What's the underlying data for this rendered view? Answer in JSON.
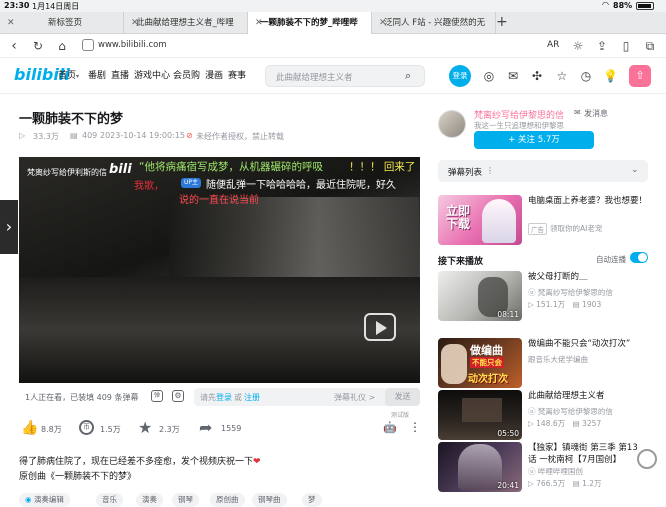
{
  "status": {
    "time": "23:30",
    "date": "1月14日周日",
    "battery": "88%"
  },
  "tabs": [
    {
      "label": "新标签页"
    },
    {
      "label": "此曲献给理想主义者_哔哩"
    },
    {
      "label": "一颗肺装不下的梦_哔哩哔"
    },
    {
      "label": "泛同人 F站 - 兴趣使然的无"
    }
  ],
  "address": {
    "url": "www.bilibili.com",
    "reader": "AR"
  },
  "header": {
    "logo": "bilibili",
    "nav": [
      "首页",
      "番剧",
      "直播",
      "游戏中心",
      "会员购",
      "漫画",
      "赛事"
    ],
    "search_placeholder": "此曲献给理想主义者",
    "login": "登录"
  },
  "video": {
    "title": "一颗肺装不下的梦",
    "plays": "33.3万",
    "danmaku": "409",
    "datetime": "2023-10-14 19:00:15",
    "reprint_notice": "未经作者授权，禁止转载",
    "watermark_user": "梵离纱写给伊利斯的信",
    "overlay_1": "“他将病痛宿写成梦，从机器碾碎的呼吸",
    "overlay_1b": "！！！ 回来了",
    "overlay_2a": "我歌，",
    "overlay_2b": "随便乱弹一下哈哈哈哈，最近住院呢，好久",
    "overlay_3": "说的一直在说当前",
    "watching": "1人正在看，已装填 409 条弹幕",
    "danmaku_prompt_a": "请先",
    "danmaku_login": "登录",
    "danmaku_or": "或",
    "danmaku_register": "注册",
    "etiquette": "弹幕礼仪 >",
    "send": "发送",
    "test_badge": "测试版",
    "like": "8.8万",
    "coin": "1.5万",
    "fav": "2.3万",
    "share": "1559",
    "desc": "得了肺病住院了，现在已经差不多痊愈，发个视频庆祝一下",
    "original": "原创曲《一颗肺装不下的梦》",
    "tags": [
      "演奏编辑",
      "音乐",
      "演奏",
      "钢琴",
      "原创曲",
      "钢琴曲",
      "梦"
    ]
  },
  "up": {
    "name": "梵离纱写给伊黎思的信",
    "message": "发消息",
    "bio": "我这一生只追理想和伊黎思",
    "follow": "+ 关注 5.7万"
  },
  "danmaku_list": "弹幕列表",
  "ad": {
    "title": "电脑桌面上养老婆？我也想要！",
    "badge": "广告",
    "desc": "领取你的AI老宠",
    "thumb_text": "立即下载"
  },
  "autoplay": {
    "label": "接下来播放",
    "toggle": "自动连播"
  },
  "recs": [
    {
      "title": "被父母打断的＿",
      "author": "梵离纱写给伊黎思的信",
      "plays": "151.1万",
      "danmaku": "1903",
      "duration": "08:11"
    },
    {
      "title": "做编曲不能只会“动次打次”",
      "author": "跟音乐大佬学编曲",
      "plays": "",
      "danmaku": "",
      "duration": "",
      "thumb_text": "做编曲",
      "thumb_text2": "不能只会",
      "thumb_text3": "动次打次"
    },
    {
      "title": "此曲献给理想主义者",
      "author": "梵离纱写给伊黎思的信",
      "plays": "148.6万",
      "danmaku": "3257",
      "duration": "05:50"
    },
    {
      "title": "【独家】镇魂街 第三季 第13话 一枕南柯【7月国创】",
      "author": "哔哩哔哩国创",
      "plays": "766.5万",
      "danmaku": "1.2万",
      "duration": "20:41"
    }
  ],
  "colors": {
    "accent": "#00aeec",
    "pink": "#fb7299",
    "dark": "#18191c"
  }
}
